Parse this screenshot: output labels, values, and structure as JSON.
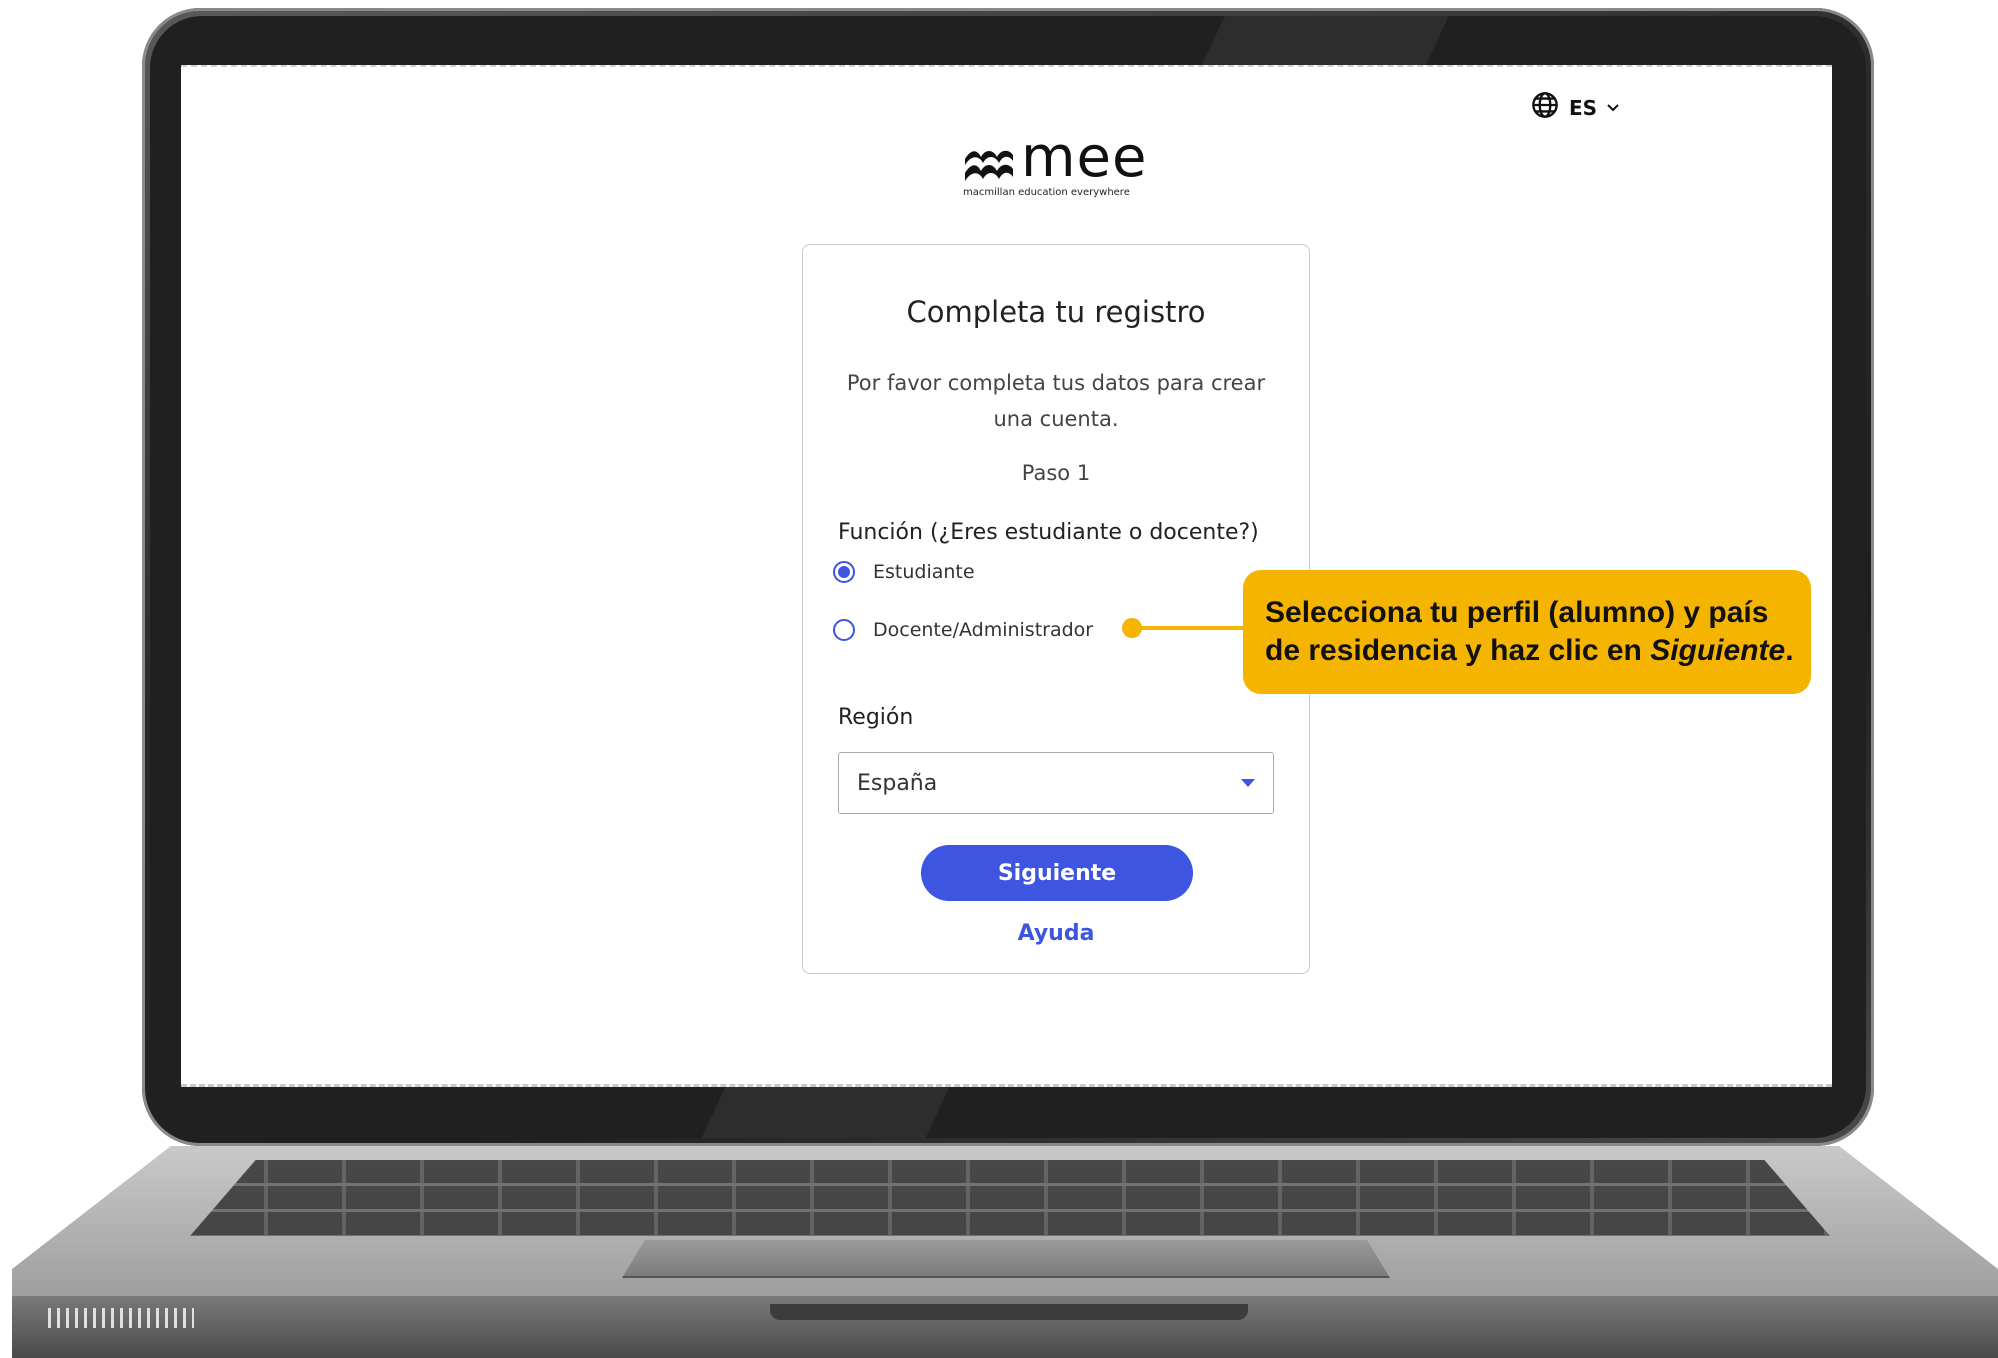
{
  "language": {
    "icon": "globe-icon",
    "code": "ES",
    "chevron": "chevron-down-icon"
  },
  "logo": {
    "wordmark": "mee",
    "tagline": "macmillan education everywhere"
  },
  "form": {
    "title": "Completa tu registro",
    "intro": "Por favor completa tus datos para crear una cuenta.",
    "step": "Paso 1",
    "role_label": "Función (¿Eres estudiante o docente?)",
    "role_options": [
      {
        "label": "Estudiante",
        "selected": true
      },
      {
        "label": "Docente/Administrador",
        "selected": false
      }
    ],
    "region_label": "Región",
    "region_value": "España",
    "next_button": "Siguiente",
    "help_link": "Ayuda"
  },
  "callout": {
    "text_line1": "Selecciona tu perfil (alumno) y país",
    "text_line2_start": "de residencia y haz clic en ",
    "text_emphasis": "Siguiente",
    "text_end": "."
  },
  "colors": {
    "accent": "#3d55e0",
    "callout": "#f5b400",
    "bezel": "#202020"
  }
}
